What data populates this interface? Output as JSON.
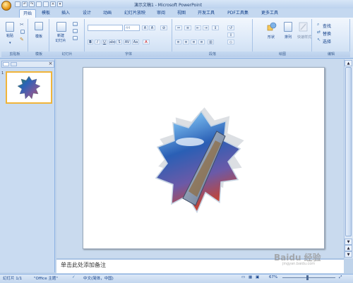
{
  "window": {
    "title": "演示文稿1 - Microsoft PowerPoint"
  },
  "ribbon": {
    "tabs": [
      "开始",
      "模板",
      "插入",
      "设计",
      "动画",
      "幻灯片放映",
      "审阅",
      "视图",
      "开发工具",
      "PDF工具集",
      "更多工具"
    ],
    "active_tab": "开始",
    "groups": {
      "clipboard": {
        "label": "剪贴板",
        "paste": "粘贴"
      },
      "template": {
        "label": "模板",
        "button": "模板"
      },
      "slides": {
        "label": "幻灯片",
        "new_slide": "新建",
        "new_slide2": "幻灯片"
      },
      "font": {
        "label": "字体",
        "size": "44"
      },
      "paragraph": {
        "label": "段落"
      },
      "drawing": {
        "label": "绘图",
        "shape": "形状",
        "arrange": "排列",
        "quick_styles": "快速样式"
      },
      "editing": {
        "label": "编辑",
        "find": "查找",
        "replace": "替换",
        "select": "选择"
      }
    }
  },
  "slide_panel": {
    "thumb_number": "1"
  },
  "notes": {
    "placeholder": "单击此处添加备注"
  },
  "status": {
    "slide": "幻灯片 1/1",
    "theme": "\"Office 主题\"",
    "language": "中文(简体，中国)",
    "zoom": "67%"
  },
  "watermark": {
    "main": "Baidu 经验",
    "sub": "jingyan.baidu.com"
  },
  "colors": {
    "accent": "#15428b",
    "ribbon": "#dbe8f8",
    "selection": "#f0b43a"
  }
}
